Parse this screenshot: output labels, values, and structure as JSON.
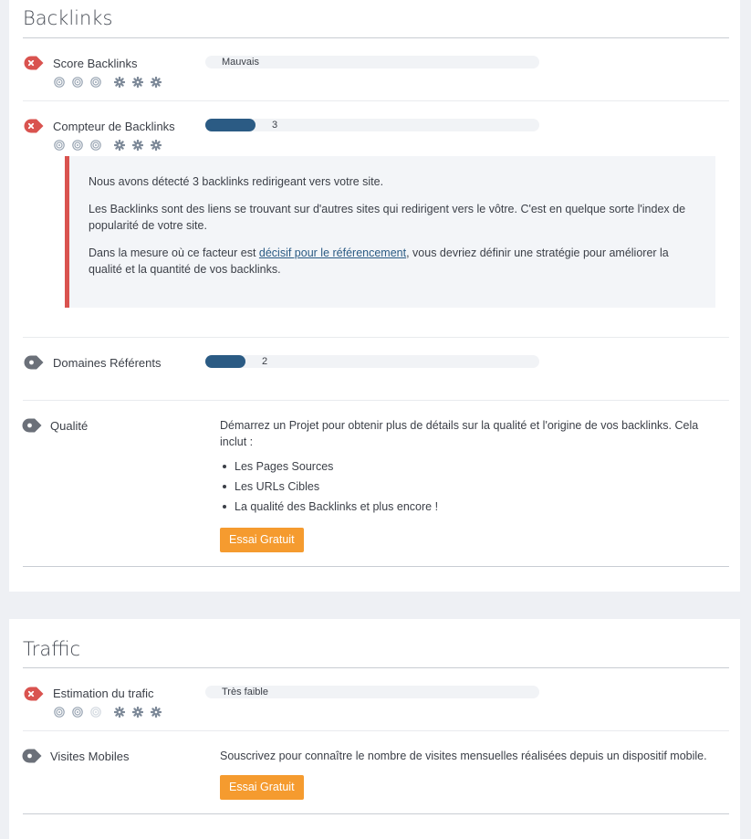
{
  "colors": {
    "bad": "#d9534f",
    "neutral": "#6b7079",
    "bar_fill": "#2b5b84",
    "button": "#f59b2f",
    "page_bg": "#eef0f4"
  },
  "backlinks": {
    "title": "Backlinks",
    "score": {
      "label": "Score Backlinks",
      "status": "error",
      "bar_text": "Mauvais",
      "rating_level": 3,
      "difficulty_level": 3
    },
    "counter": {
      "label": "Compteur de Backlinks",
      "status": "error",
      "value": "3",
      "fill_fraction": 0.15,
      "rating_level": 3,
      "difficulty_level": 3,
      "alert": {
        "p1": "Nous avons détecté 3 backlinks redirigeant vers votre site.",
        "p2": "Les Backlinks sont des liens se trouvant sur d'autres sites qui redirigent vers le vôtre. C'est en quelque sorte l'index de popularité de votre site.",
        "p3_before": "Dans la mesure où ce facteur est ",
        "p3_link": "décisif pour le référencement",
        "p3_after": ", vous devriez définir une stratégie pour améliorer la qualité et la quantité de vos backlinks."
      }
    },
    "domains": {
      "label": "Domaines Référents",
      "status": "info",
      "value": "2",
      "fill_fraction": 0.12
    },
    "quality": {
      "label": "Qualité",
      "status": "info",
      "description": "Démarrez un Projet pour obtenir plus de détails sur la qualité et l'origine de vos backlinks. Cela inclut :",
      "items": [
        "Les Pages Sources",
        "Les URLs Cibles",
        "La qualité des Backlinks et plus encore !"
      ],
      "button": "Essai Gratuit"
    }
  },
  "traffic": {
    "title": "Traffic",
    "estimation": {
      "label": "Estimation du trafic",
      "status": "error",
      "bar_text": "Très faible",
      "rating_level": 2,
      "difficulty_level": 3
    },
    "mobile": {
      "label": "Visites Mobiles",
      "status": "info",
      "description": "Souscrivez pour connaître le nombre de visites mensuelles réalisées depuis un dispositif mobile.",
      "button": "Essai Gratuit"
    }
  }
}
